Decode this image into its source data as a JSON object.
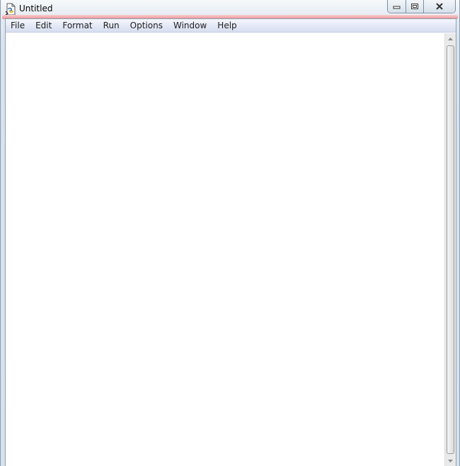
{
  "window": {
    "title": "Untitled",
    "icon": "python-idle-icon"
  },
  "caption_buttons": {
    "minimize": "minimize-icon",
    "maximize": "restore-icon",
    "close": "close-icon"
  },
  "menubar": {
    "items": [
      {
        "label": "File"
      },
      {
        "label": "Edit"
      },
      {
        "label": "Format"
      },
      {
        "label": "Run"
      },
      {
        "label": "Options"
      },
      {
        "label": "Window"
      },
      {
        "label": "Help"
      }
    ]
  },
  "editor": {
    "content": ""
  },
  "colors": {
    "frame_accent": "#e88d91",
    "menubar": "#e3e8f6",
    "editor_background": "#ffffff"
  }
}
